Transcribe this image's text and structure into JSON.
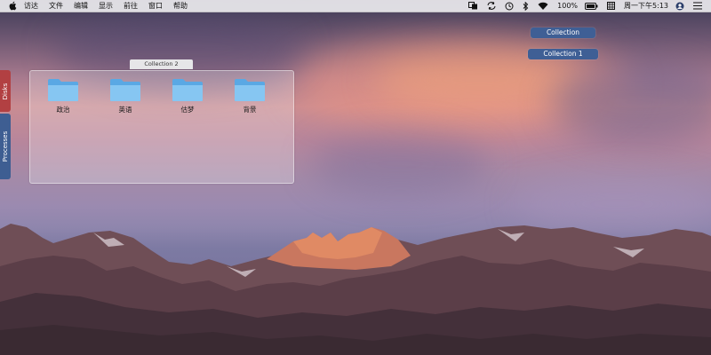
{
  "menubar": {
    "apple_icon": "apple-logo-icon",
    "items": [
      "访达",
      "文件",
      "编辑",
      "显示",
      "前往",
      "窗口",
      "帮助"
    ],
    "status": {
      "battery_percent": "100%",
      "clock": "周一下午5:13"
    }
  },
  "window": {
    "title": "Collection 2",
    "folders": [
      {
        "label": "政治",
        "icon": "folder-icon"
      },
      {
        "label": "英语",
        "icon": "folder-icon"
      },
      {
        "label": "估梦",
        "icon": "folder-icon"
      },
      {
        "label": "背景",
        "icon": "folder-icon"
      }
    ]
  },
  "side_tabs": {
    "disks": "Disks",
    "processes": "Processes"
  },
  "buttons": {
    "collection": "Collection",
    "collection1": "Collection 1"
  },
  "colors": {
    "disks_tab": "#b24042",
    "processes_tab": "#3e5e92",
    "collection_button": "#3f5f95",
    "folder_blue": "#7cc0ee"
  }
}
